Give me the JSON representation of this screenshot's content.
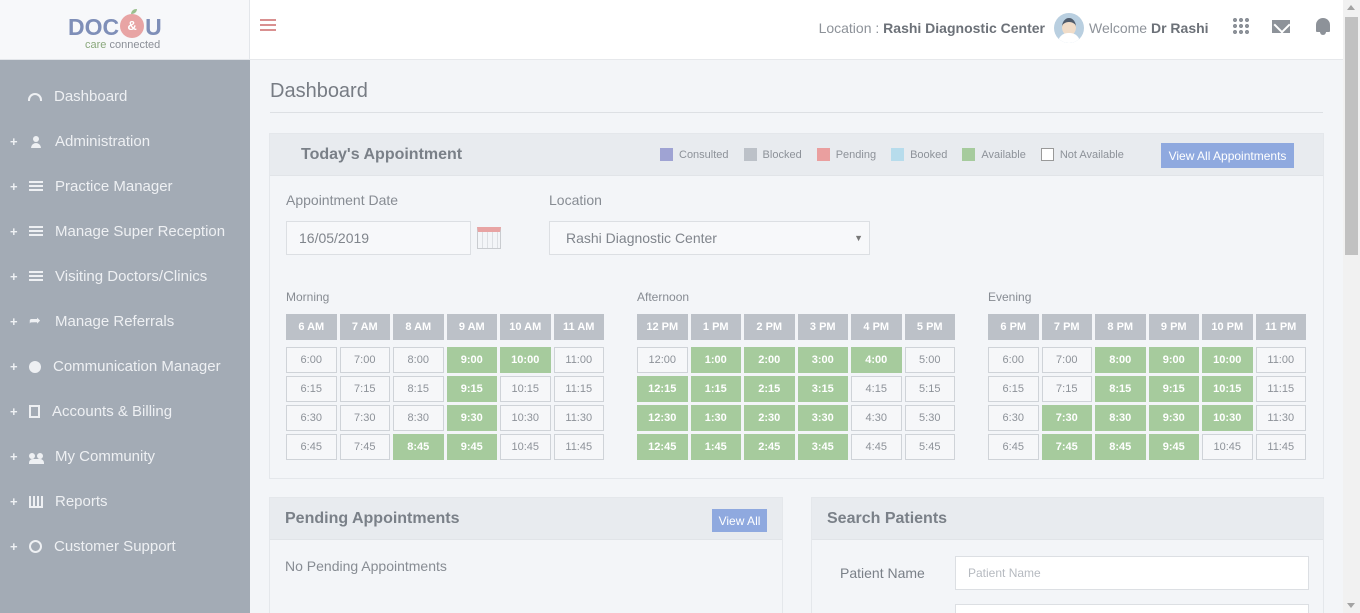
{
  "logo": {
    "text_left": "DOC",
    "text_mid": "&",
    "text_right": "U",
    "tagline_care": "care",
    "tagline_connected": "connected"
  },
  "header": {
    "location_label": "Location :",
    "location_value": "Rashi Diagnostic Center",
    "welcome_label": "Welcome",
    "welcome_name": "Dr Rashi"
  },
  "sidebar": {
    "items": [
      {
        "label": "Dashboard",
        "icon": "dashboard-icon",
        "expandable": false
      },
      {
        "label": "Administration",
        "icon": "user-icon",
        "expandable": true
      },
      {
        "label": "Practice Manager",
        "icon": "list-icon",
        "expandable": true
      },
      {
        "label": "Manage Super Reception",
        "icon": "list-icon",
        "expandable": true
      },
      {
        "label": "Visiting Doctors/Clinics",
        "icon": "list-icon",
        "expandable": true
      },
      {
        "label": "Manage Referrals",
        "icon": "share-icon",
        "expandable": true
      },
      {
        "label": "Communication Manager",
        "icon": "send-icon",
        "expandable": true
      },
      {
        "label": "Accounts & Billing",
        "icon": "file-icon",
        "expandable": true
      },
      {
        "label": "My Community",
        "icon": "group-icon",
        "expandable": true
      },
      {
        "label": "Reports",
        "icon": "chart-icon",
        "expandable": true
      },
      {
        "label": "Customer Support",
        "icon": "globe-icon",
        "expandable": true
      }
    ]
  },
  "page": {
    "title": "Dashboard"
  },
  "appointments": {
    "title": "Today's Appointment",
    "legend": [
      {
        "label": "Consulted",
        "color": "#9fa3d3"
      },
      {
        "label": "Blocked",
        "color": "#bcc1c8"
      },
      {
        "label": "Pending",
        "color": "#ea9f9f"
      },
      {
        "label": "Booked",
        "color": "#b7dcec"
      },
      {
        "label": "Available",
        "color": "#a6cb9d"
      },
      {
        "label": "Not Available",
        "color": "#ffffff"
      }
    ],
    "view_all_label": "View All Appointments",
    "date_label": "Appointment Date",
    "date_value": "16/05/2019",
    "location_label": "Location",
    "location_value": "Rashi Diagnostic Center",
    "groups": [
      {
        "label": "Morning",
        "hours": [
          "6 AM",
          "7 AM",
          "8 AM",
          "9 AM",
          "10 AM",
          "11 AM"
        ],
        "rows": [
          [
            {
              "t": "6:00",
              "a": false
            },
            {
              "t": "7:00",
              "a": false
            },
            {
              "t": "8:00",
              "a": false
            },
            {
              "t": "9:00",
              "a": true
            },
            {
              "t": "10:00",
              "a": true
            },
            {
              "t": "11:00",
              "a": false
            }
          ],
          [
            {
              "t": "6:15",
              "a": false
            },
            {
              "t": "7:15",
              "a": false
            },
            {
              "t": "8:15",
              "a": false
            },
            {
              "t": "9:15",
              "a": true
            },
            {
              "t": "10:15",
              "a": false
            },
            {
              "t": "11:15",
              "a": false
            }
          ],
          [
            {
              "t": "6:30",
              "a": false
            },
            {
              "t": "7:30",
              "a": false
            },
            {
              "t": "8:30",
              "a": false
            },
            {
              "t": "9:30",
              "a": true
            },
            {
              "t": "10:30",
              "a": false
            },
            {
              "t": "11:30",
              "a": false
            }
          ],
          [
            {
              "t": "6:45",
              "a": false
            },
            {
              "t": "7:45",
              "a": false
            },
            {
              "t": "8:45",
              "a": true
            },
            {
              "t": "9:45",
              "a": true
            },
            {
              "t": "10:45",
              "a": false
            },
            {
              "t": "11:45",
              "a": false
            }
          ]
        ]
      },
      {
        "label": "Afternoon",
        "hours": [
          "12 PM",
          "1 PM",
          "2 PM",
          "3 PM",
          "4 PM",
          "5 PM"
        ],
        "rows": [
          [
            {
              "t": "12:00",
              "a": false
            },
            {
              "t": "1:00",
              "a": true
            },
            {
              "t": "2:00",
              "a": true
            },
            {
              "t": "3:00",
              "a": true
            },
            {
              "t": "4:00",
              "a": true
            },
            {
              "t": "5:00",
              "a": false
            }
          ],
          [
            {
              "t": "12:15",
              "a": true
            },
            {
              "t": "1:15",
              "a": true
            },
            {
              "t": "2:15",
              "a": true
            },
            {
              "t": "3:15",
              "a": true
            },
            {
              "t": "4:15",
              "a": false
            },
            {
              "t": "5:15",
              "a": false
            }
          ],
          [
            {
              "t": "12:30",
              "a": true
            },
            {
              "t": "1:30",
              "a": true
            },
            {
              "t": "2:30",
              "a": true
            },
            {
              "t": "3:30",
              "a": true
            },
            {
              "t": "4:30",
              "a": false
            },
            {
              "t": "5:30",
              "a": false
            }
          ],
          [
            {
              "t": "12:45",
              "a": true
            },
            {
              "t": "1:45",
              "a": true
            },
            {
              "t": "2:45",
              "a": true
            },
            {
              "t": "3:45",
              "a": true
            },
            {
              "t": "4:45",
              "a": false
            },
            {
              "t": "5:45",
              "a": false
            }
          ]
        ]
      },
      {
        "label": "Evening",
        "hours": [
          "6 PM",
          "7 PM",
          "8 PM",
          "9 PM",
          "10 PM",
          "11 PM"
        ],
        "rows": [
          [
            {
              "t": "6:00",
              "a": false
            },
            {
              "t": "7:00",
              "a": false
            },
            {
              "t": "8:00",
              "a": true
            },
            {
              "t": "9:00",
              "a": true
            },
            {
              "t": "10:00",
              "a": true
            },
            {
              "t": "11:00",
              "a": false
            }
          ],
          [
            {
              "t": "6:15",
              "a": false
            },
            {
              "t": "7:15",
              "a": false
            },
            {
              "t": "8:15",
              "a": true
            },
            {
              "t": "9:15",
              "a": true
            },
            {
              "t": "10:15",
              "a": true
            },
            {
              "t": "11:15",
              "a": false
            }
          ],
          [
            {
              "t": "6:30",
              "a": false
            },
            {
              "t": "7:30",
              "a": true
            },
            {
              "t": "8:30",
              "a": true
            },
            {
              "t": "9:30",
              "a": true
            },
            {
              "t": "10:30",
              "a": true
            },
            {
              "t": "11:30",
              "a": false
            }
          ],
          [
            {
              "t": "6:45",
              "a": false
            },
            {
              "t": "7:45",
              "a": true
            },
            {
              "t": "8:45",
              "a": true
            },
            {
              "t": "9:45",
              "a": true
            },
            {
              "t": "10:45",
              "a": false
            },
            {
              "t": "11:45",
              "a": false
            }
          ]
        ]
      }
    ]
  },
  "pending": {
    "title": "Pending Appointments",
    "view_all_label": "View All",
    "empty_text": "No Pending Appointments"
  },
  "search": {
    "title": "Search Patients",
    "patient_name_label": "Patient Name",
    "patient_name_placeholder": "Patient Name"
  }
}
